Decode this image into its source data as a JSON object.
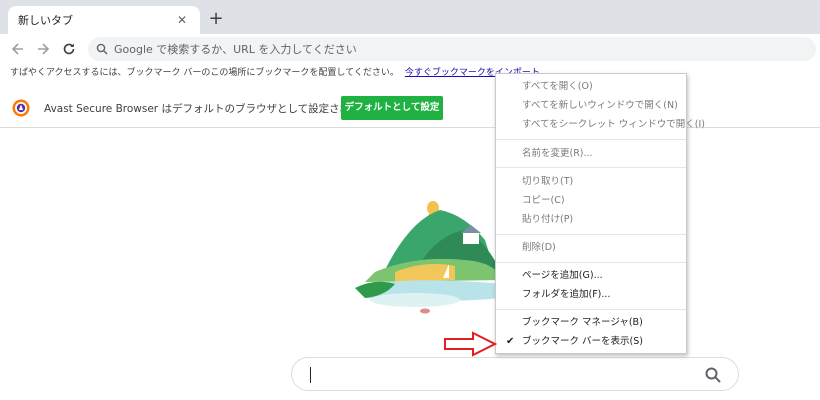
{
  "tab": {
    "title": "新しいタブ",
    "close_icon": "close-icon"
  },
  "toolbar": {
    "back_icon": "back-arrow-icon",
    "forward_icon": "forward-arrow-icon",
    "reload_icon": "reload-icon",
    "omnibox_placeholder": "Google で検索するか、URL を入力してください"
  },
  "bookmark_bar": {
    "message": "すばやくアクセスするには、ブックマーク バーのこの場所にブックマークを配置してください。",
    "import_link": "今すぐブックマークをインポート..."
  },
  "infobar": {
    "message": "Avast Secure Browser はデフォルトのブラウザとして設定されていません",
    "button_label": "デフォルトとして設定",
    "button_color": "#1fb141"
  },
  "context_menu": {
    "items": [
      {
        "label": "すべてを開く(O)",
        "enabled": false
      },
      {
        "label": "すべてを新しいウィンドウで開く(N)",
        "enabled": false
      },
      {
        "label": "すべてをシークレット ウィンドウで開く(I)",
        "enabled": false
      },
      {
        "label": "名前を変更(R)...",
        "enabled": false
      },
      {
        "label": "切り取り(T)",
        "enabled": false
      },
      {
        "label": "コピー(C)",
        "enabled": false
      },
      {
        "label": "貼り付け(P)",
        "enabled": false
      },
      {
        "label": "削除(D)",
        "enabled": false
      },
      {
        "label": "ページを追加(G)...",
        "enabled": true
      },
      {
        "label": "フォルダを追加(F)...",
        "enabled": true
      },
      {
        "label": "ブックマーク マネージャ(B)",
        "enabled": true
      },
      {
        "label": "ブックマーク バーを表示(S)",
        "enabled": true,
        "checked": true
      }
    ]
  },
  "annotation": {
    "arrow_color": "#e02020"
  }
}
